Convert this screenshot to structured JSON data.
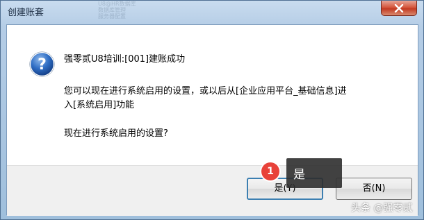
{
  "window": {
    "title": "创建账套",
    "background_text": "U8@HR数据库\n数据库管理\n服务器配置"
  },
  "dialog": {
    "icon": "question-icon",
    "headline": "强零贰U8培训:[001]建账成功",
    "line1": "您可以现在进行系统启用的设置，或以后从[企业应用平台_基础信息]进",
    "line2": "入[系统启用]功能",
    "question": "现在进行系统启用的设置?",
    "yes_label": "是(Y)",
    "no_label": "否(N)"
  },
  "annotation": {
    "step_number": "1",
    "tooltip_text": "是"
  },
  "watermark": "头条 @强零贰",
  "colors": {
    "close_button": "#c33a22",
    "badge": "#e8423a",
    "tooltip_bg": "#2d2d2d",
    "default_button_border": "#3c7fb1"
  }
}
